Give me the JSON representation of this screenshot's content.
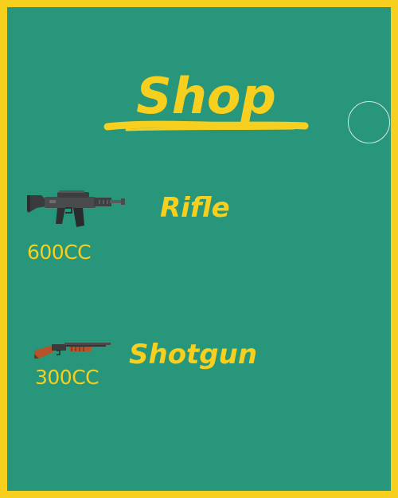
{
  "shop": {
    "title": "Shop",
    "items": [
      {
        "name": "Rifle",
        "price": "600CC",
        "image": "rifle-icon"
      },
      {
        "name": "Shotgun",
        "price": "300CC",
        "image": "shotgun-icon"
      }
    ]
  },
  "colors": {
    "background": "#27967a",
    "border": "#f7cf1e",
    "text": "#f7cf1e"
  },
  "icons": {
    "close": "circle-button-icon"
  }
}
